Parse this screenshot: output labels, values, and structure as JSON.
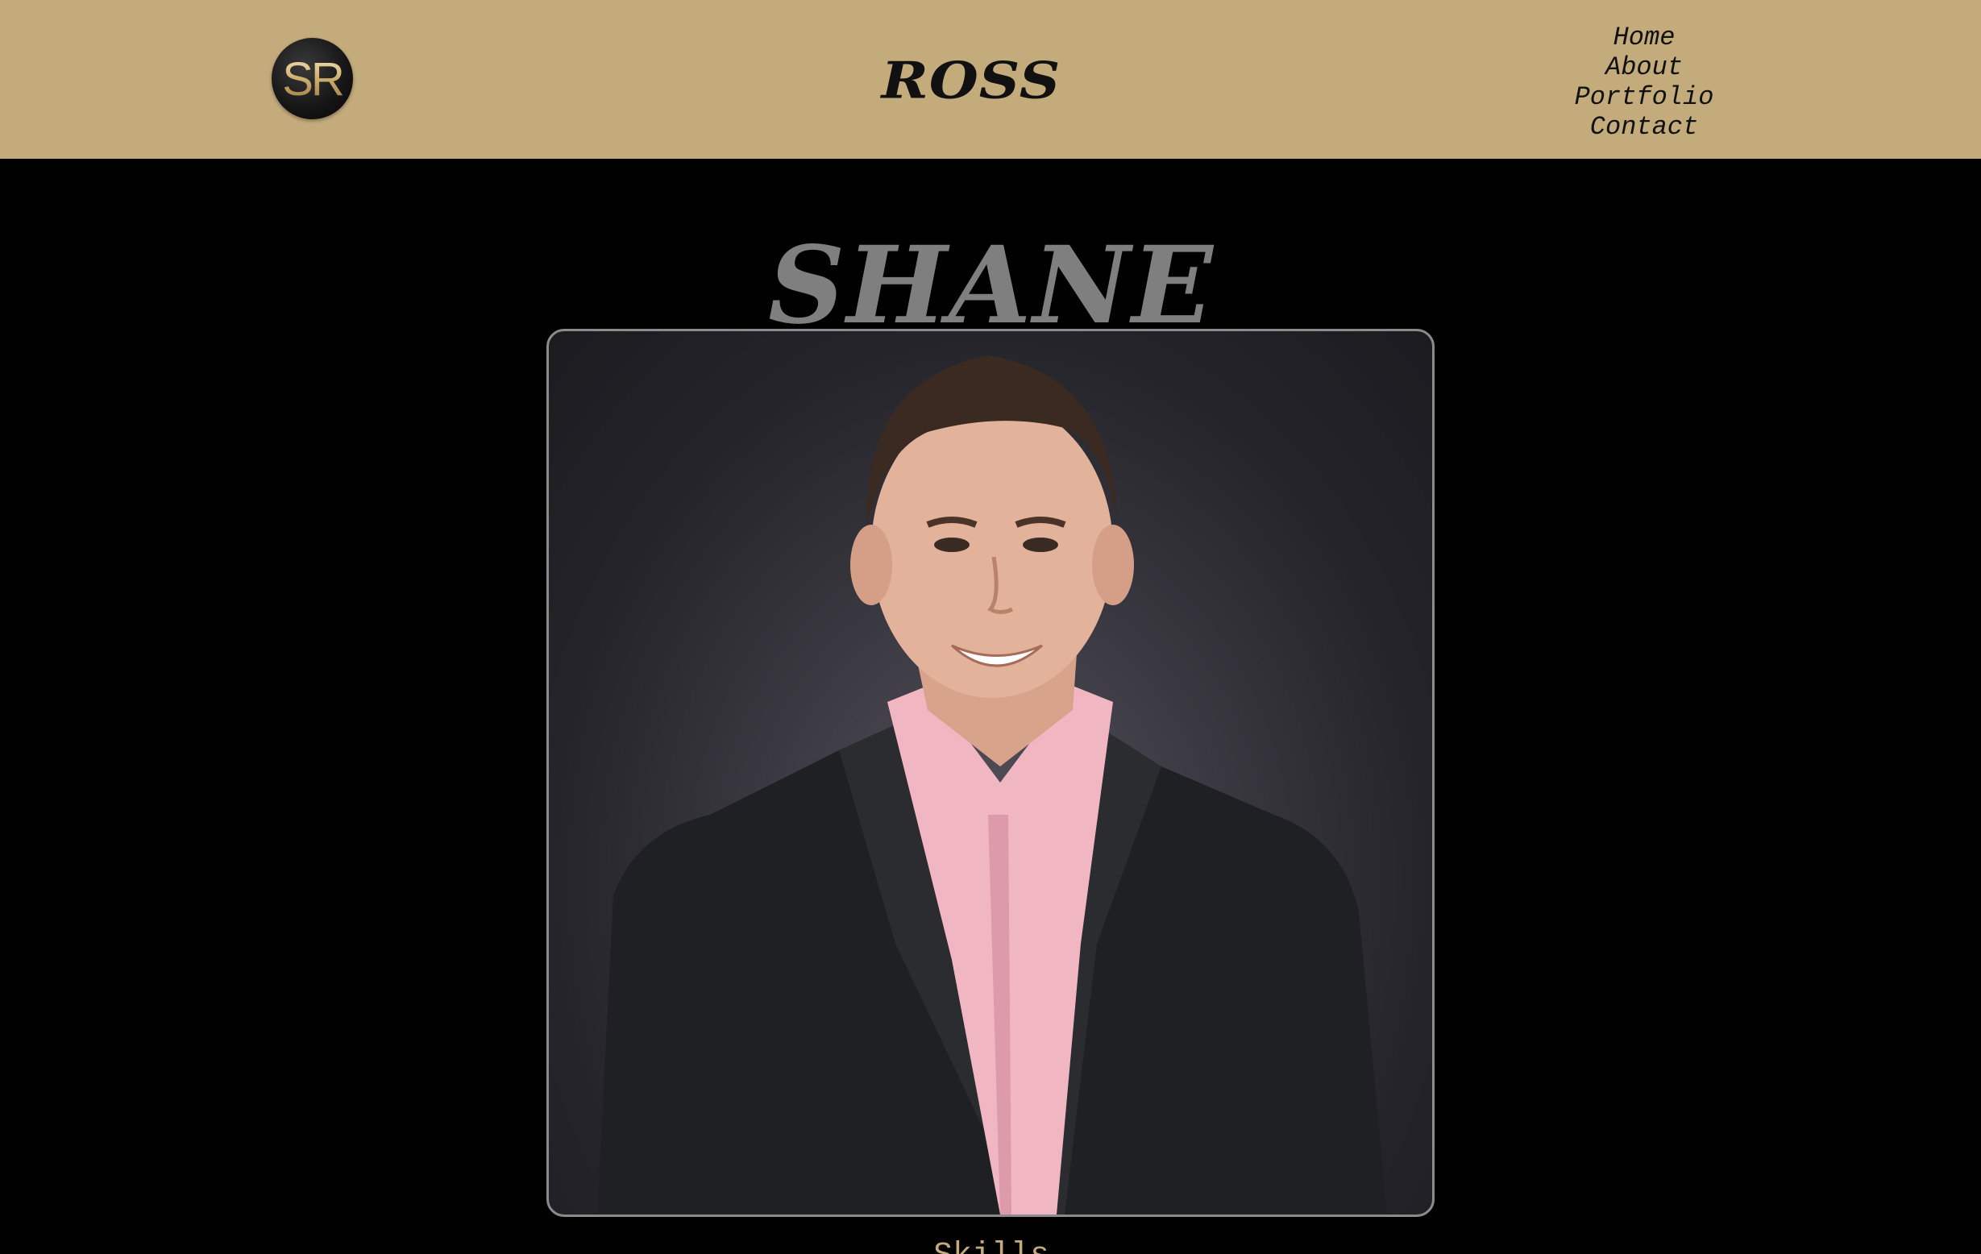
{
  "header": {
    "logo_text": "SR",
    "site_title": "Ross",
    "nav": [
      {
        "label": "Home"
      },
      {
        "label": "About"
      },
      {
        "label": "Portfolio"
      },
      {
        "label": "Contact"
      }
    ]
  },
  "hero": {
    "name": "Shane",
    "portrait_icon": "portrait-photo"
  },
  "skills": {
    "heading": "Skills"
  },
  "colors": {
    "header_bg": "#c4ab7c",
    "page_bg": "#000000",
    "hero_name": "#7f7f7f",
    "accent_gold": "#c4ab7c"
  }
}
